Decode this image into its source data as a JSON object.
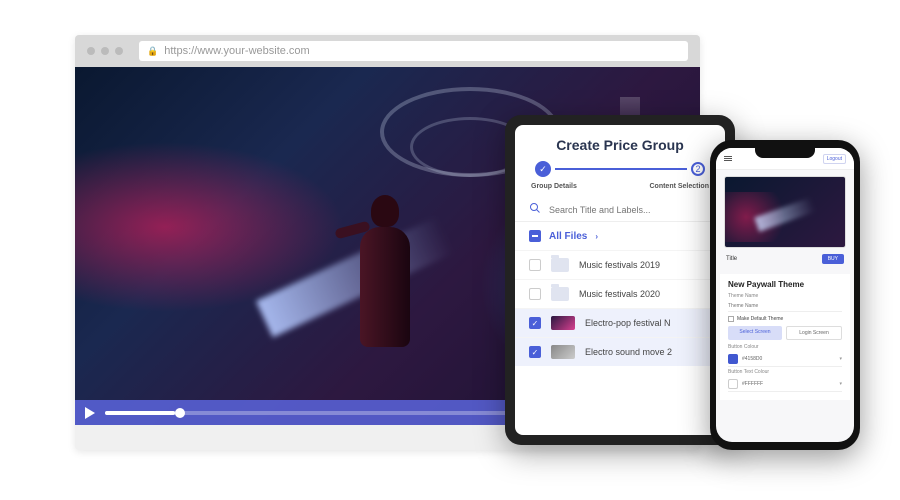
{
  "browser": {
    "url": "https://www.your-website.com"
  },
  "tablet": {
    "title": "Create Price Group",
    "steps": {
      "step1": "Group Details",
      "step2": "Content Selection",
      "step2_num": "2"
    },
    "search_placeholder": "Search Title and Labels...",
    "files_header": "All Files",
    "rows": [
      {
        "label": "Music festivals 2019",
        "selected": false,
        "type": "folder"
      },
      {
        "label": "Music festivals 2020",
        "selected": false,
        "type": "folder"
      },
      {
        "label": "Electro-pop festival N",
        "selected": true,
        "type": "video"
      },
      {
        "label": "Electro sound move 2",
        "selected": true,
        "type": "video"
      }
    ]
  },
  "phone": {
    "logout": "Logout",
    "video_title": "Title",
    "buy": "BUY",
    "theme_section": "New Paywall Theme",
    "theme_name_label": "Theme Name",
    "theme_name_placeholder": "Theme Name",
    "make_default": "Make Default Theme",
    "tabs": {
      "select": "Select Screen",
      "login": "Login Screen"
    },
    "button_colour_label": "Button Colour",
    "button_colour_hex": "#4158D0",
    "button_text_label": "Button Text Colour",
    "button_text_hex": "#FFFFFF"
  }
}
